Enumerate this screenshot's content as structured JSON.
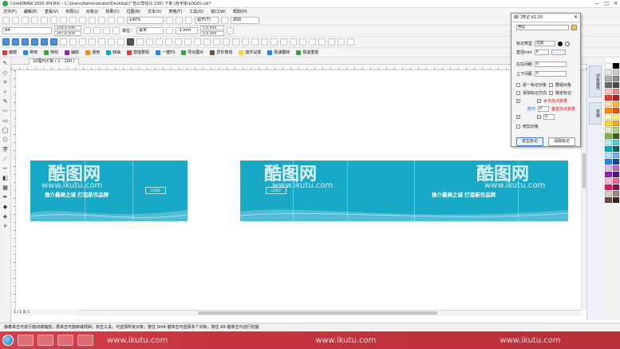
{
  "window": {
    "title": "CorelDRAW 2020 (64-Bit) - C:\\Users\\Administrator\\Desktop\\广告公司包(1:100) 下单 (含字体\\LOGO).cdr*",
    "controls": [
      "—",
      "□",
      "✕"
    ]
  },
  "menu": [
    "文件(F)",
    "编辑(E)",
    "查看(V)",
    "布局(L)",
    "对象(J)",
    "效果(C)",
    "位图(B)",
    "文本(X)",
    "表格(T)",
    "工具(O)",
    "窗口(W)",
    "帮助(H)"
  ],
  "toolbar1": {
    "zoom": "140%",
    "snap_label": "贴齐(T)",
    "launch_label": "启动"
  },
  "toolbar2": {
    "page_size": "A4",
    "width": "210.0 mm",
    "height": "297.0 mm",
    "units_label": "单位：",
    "units": "毫米",
    "nudge": ".1 mm",
    "dup_x": "5.0 mm",
    "dup_y": "5.0 mm"
  },
  "plugins": [
    "魔镜",
    "常用",
    "特效",
    "辅助",
    "通用",
    "转曲",
    "智能群组",
    "一键PS",
    "导出图片",
    "异形角线",
    "插件设置",
    "极速翻转",
    "极速重复"
  ],
  "document_tab": "10厘PVC板 ( 1 : 100 )",
  "banners": [
    {
      "slogan": "推介最美之城   打造新农品牌",
      "logo_text": "LOGO"
    },
    {
      "slogan": "推介最美之城   打造新农品牌",
      "logo_text": "LOGO"
    }
  ],
  "watermark": {
    "brand": "酷图网",
    "url": "www.ikutu.com"
  },
  "page_nav": "1 / 1  页 1",
  "status": "接着单击可进行拖动或缩放；再单击可旋转或倾斜；双击工具，可选择所有对象；按住 Shift 键单击可选择多个对象；按住 Alt 键单击可进行挖掘",
  "dock_tabs": [
    "对象属性",
    "变换"
  ],
  "dialog": {
    "title": "做门符记 V1.20",
    "preset": "预设",
    "mark_type_label": "标记类型",
    "mark_type": "实圆",
    "diameter_label": "直径mm",
    "diameter": "6",
    "lr_margin_label": "左右间距",
    "lr_margin": "6",
    "tb_margin_label": "上下间距",
    "tb_margin": "6",
    "opt_merge": "逐一标记对象",
    "opt_group": "群组对象",
    "opt_add": "添加标记方向",
    "opt_lock": "锁定标记",
    "horiz_label": "水平加点数量",
    "horiz": "0",
    "vert_label": "垂直加点数量",
    "vert": "0",
    "opt_center": "居中",
    "opt_fix": "修剪对象",
    "locate_btn": "定位标记",
    "clear_btn": "清除标记"
  },
  "colors": {
    "banner": "#18a9c7",
    "taskbar": "#c7353f",
    "accent_red": "#d11111"
  },
  "palette": [
    "#ffffff",
    "#000000",
    "#e8e8e8",
    "#cfcfcf",
    "#b0b0b0",
    "#8d8d8d",
    "#6a6a6a",
    "#4a4a4a",
    "#f5c6c6",
    "#e88b8b",
    "#e53935",
    "#b71c1c",
    "#ffe0b2",
    "#ffb74d",
    "#fb8c00",
    "#e65100",
    "#fff9c4",
    "#fff176",
    "#fdd835",
    "#f9a825",
    "#dcedc8",
    "#aed581",
    "#7cb342",
    "#33691e",
    "#b2ebf2",
    "#4dd0e1",
    "#00acc1",
    "#006064",
    "#bbdefb",
    "#64b5f6",
    "#1e88e5",
    "#0d47a1",
    "#e1bee7",
    "#ba68c8",
    "#8e24aa",
    "#4a148c",
    "#f8bbd0",
    "#f06292",
    "#d81b60",
    "#880e4f",
    "#d7ccc8",
    "#a1887f",
    "#6d4c41",
    "#3e2723"
  ]
}
